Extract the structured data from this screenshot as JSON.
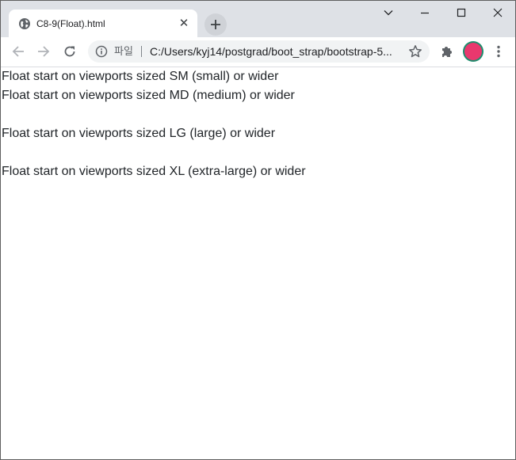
{
  "browser": {
    "tab": {
      "title": "C8-9(Float).html",
      "close_glyph": "✕",
      "favicon": "globe-icon"
    },
    "window_controls": [
      "chevron-down-icon",
      "minimize-icon",
      "maximize-icon",
      "close-icon"
    ],
    "omnibox": {
      "scheme_label": "파일",
      "url": "C:/Users/kyj14/postgrad/boot_strap/bootstrap-5..."
    },
    "profile_color": "#e9386e",
    "profile_ring_color": "#1e8e6e"
  },
  "page": {
    "lines": [
      "Float start on viewports sized SM (small) or wider",
      "Float start on viewports sized MD (medium) or wider",
      "Float start on viewports sized LG (large) or wider",
      "Float start on viewports sized XL (extra-large) or wider"
    ],
    "text_color": "#212529"
  }
}
